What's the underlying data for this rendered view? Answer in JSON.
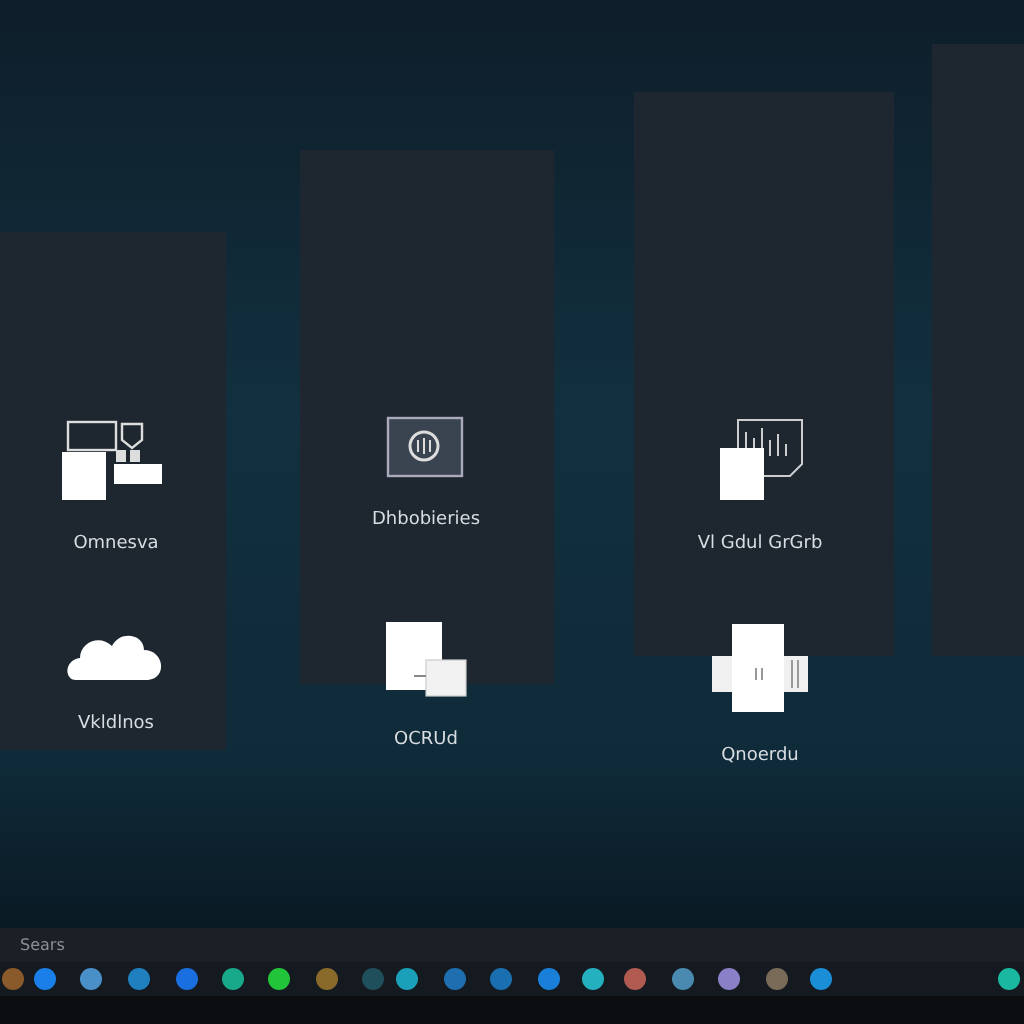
{
  "panels": [
    {
      "kind": "panel"
    },
    {
      "kind": "panel"
    },
    {
      "kind": "panel"
    },
    {
      "kind": "panel"
    }
  ],
  "apps": [
    {
      "kind": "windows",
      "label": "Omnesva"
    },
    {
      "kind": "monitor",
      "label": "Dhbobieries"
    },
    {
      "kind": "chart",
      "label": "Vl Gdul GrGrb"
    },
    {
      "kind": "cloud",
      "label": "Vkldlnos"
    },
    {
      "kind": "document",
      "label": "OCRUd"
    },
    {
      "kind": "printer",
      "label": "Qnoerdu"
    }
  ],
  "taskbar": {
    "search_placeholder": "Sears",
    "icons": [
      {
        "color": "#8a5a2a"
      },
      {
        "color": "#1a7fe8"
      },
      {
        "color": "#4a90c8"
      },
      {
        "color": "#1f7fbf"
      },
      {
        "color": "#1a6fe0"
      },
      {
        "color": "#18a88a"
      },
      {
        "color": "#22c43a"
      },
      {
        "color": "#8a6a2a"
      },
      {
        "color": "#1f4f5a"
      },
      {
        "color": "#1aa0b8"
      },
      {
        "color": "#1f6fb0"
      },
      {
        "color": "#1a6fb0"
      },
      {
        "color": "#1a7fd8"
      },
      {
        "color": "#25b0c0"
      },
      {
        "color": "#b05a50"
      },
      {
        "color": "#4a8ab0"
      },
      {
        "color": "#8a80c8"
      },
      {
        "color": "#7a6a58"
      },
      {
        "color": "#1a8fd8"
      },
      {
        "color": "#1ab8a0"
      }
    ]
  }
}
